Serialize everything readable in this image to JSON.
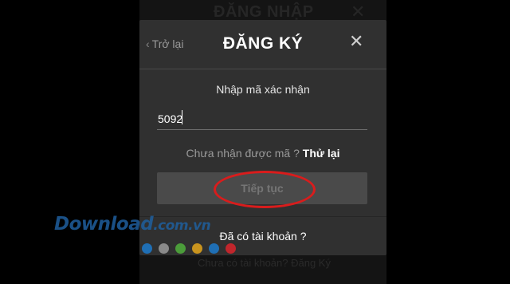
{
  "background_modal": {
    "title": "ĐĂNG NHẬP",
    "close_glyph": "✕",
    "footer": "Chưa có tài khoản? Đăng Ký"
  },
  "modal": {
    "back_label": "Trở lại",
    "back_icon": "chevron-left-icon",
    "title": "ĐĂNG KÝ",
    "close_glyph": "✕",
    "prompt": "Nhập mã xác nhận",
    "code_value": "5092",
    "resend_question": "Chưa nhận được mã ?",
    "resend_link": "Thử lại",
    "continue_label": "Tiếp tục",
    "have_account": "Đã có tài khoản ?"
  },
  "annotation": {
    "highlight_color": "#d91c1c"
  },
  "watermark": {
    "text": "Download",
    "suffix": ".com.vn",
    "dot_colors": [
      "#1f6fb5",
      "#8a8a8a",
      "#4b9c3a",
      "#c9941e",
      "#1f6fb5",
      "#c0262c"
    ]
  }
}
